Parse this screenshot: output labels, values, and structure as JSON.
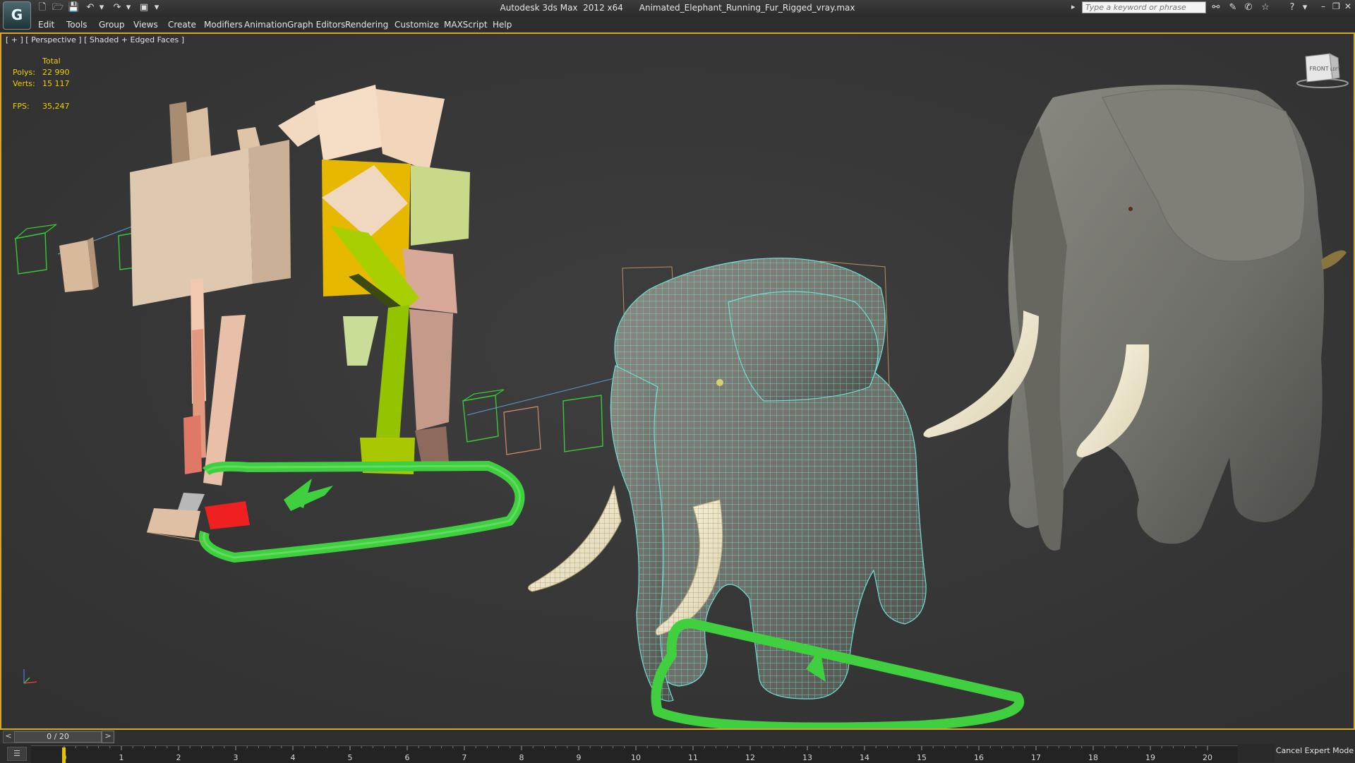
{
  "title": "Autodesk 3ds Max  2012 x64      Animated_Elephant_Running_Fur_Rigged_vray.max",
  "app_logo": "3ds-max-logo",
  "search": {
    "placeholder": "Type a keyword or phrase"
  },
  "menu": [
    "Edit",
    "Tools",
    "Group",
    "Views",
    "Create",
    "Modifiers",
    "Animation",
    "Graph Editors",
    "Rendering",
    "Customize",
    "MAXScript",
    "Help"
  ],
  "viewport": {
    "label": "[ + ] [ Perspective ] [ Shaded + Edged Faces ]",
    "stats": {
      "header": "Total",
      "polys_label": "Polys:",
      "polys_value": "22 990",
      "verts_label": "Verts:",
      "verts_value": "15 117",
      "fps_label": "FPS:",
      "fps_value": "35,247"
    },
    "viewcube": {
      "front": "FRONT",
      "left": "LEFT"
    }
  },
  "time_slider": {
    "value": "0 / 20",
    "prev": "<",
    "next": ">"
  },
  "timeline": {
    "ticks": [
      "0",
      "1",
      "2",
      "3",
      "4",
      "5",
      "6",
      "7",
      "8",
      "9",
      "10",
      "11",
      "12",
      "13",
      "14",
      "15",
      "16",
      "17",
      "18",
      "19",
      "20"
    ]
  },
  "cancel_expert_mode": "Cancel Expert Mode",
  "colors": {
    "viewport_border": "#d4a82a",
    "stats_text": "#f0d000",
    "viewport_bg": "#393939"
  }
}
